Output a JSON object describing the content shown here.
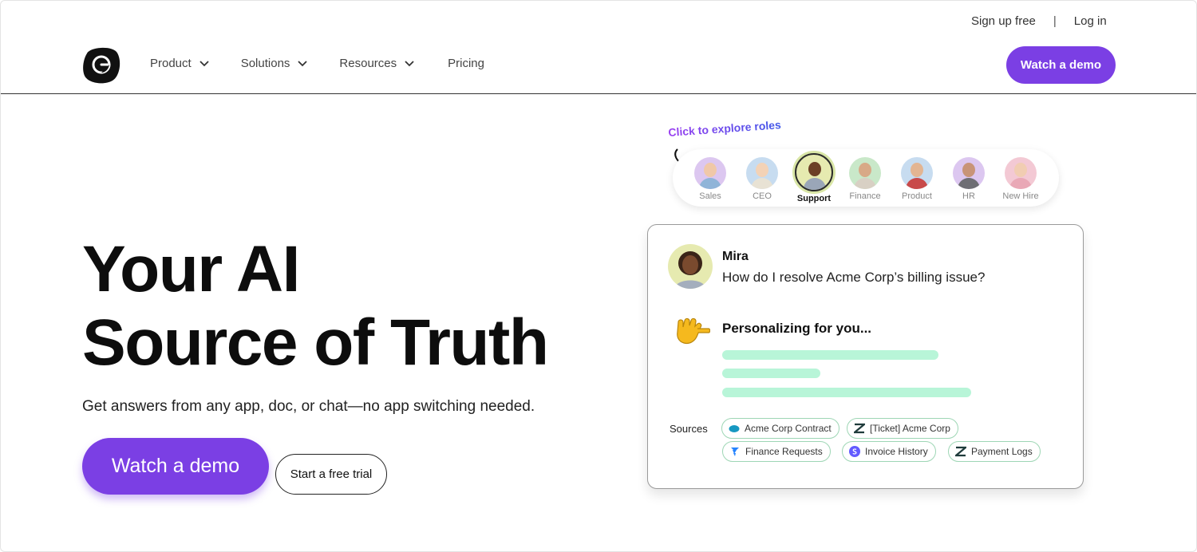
{
  "util": {
    "signup": "Sign up free",
    "separator": "|",
    "login": "Log in"
  },
  "nav": {
    "items": [
      {
        "label": "Product"
      },
      {
        "label": "Solutions"
      },
      {
        "label": "Resources"
      },
      {
        "label": "Pricing"
      }
    ],
    "cta": "Watch a demo"
  },
  "hero": {
    "title_line1": "Your AI",
    "title_line2": "Source of Truth",
    "subtitle": "Get answers from any app, doc, or chat—no app switching needed.",
    "primary_button": "Watch a demo",
    "secondary_button": "Start a free trial"
  },
  "roles": {
    "prompt": "Click to explore roles",
    "selected": "Support",
    "items": [
      {
        "label": "Sales"
      },
      {
        "label": "CEO"
      },
      {
        "label": "Support"
      },
      {
        "label": "Finance"
      },
      {
        "label": "Product"
      },
      {
        "label": "HR"
      },
      {
        "label": "New Hire"
      }
    ]
  },
  "chat": {
    "name": "Mira",
    "question": "How do I resolve Acme Corp’s billing issue?",
    "status": "Personalizing for you...",
    "sources_label": "Sources",
    "sources": [
      {
        "label": "Acme Corp Contract",
        "icon": "salesforce-icon"
      },
      {
        "label": "[Ticket] Acme Corp",
        "icon": "zendesk-icon"
      },
      {
        "label": "Finance Requests",
        "icon": "jira-icon"
      },
      {
        "label": "Invoice History",
        "icon": "stripe-icon"
      },
      {
        "label": "Payment Logs",
        "icon": "zendesk-icon"
      }
    ]
  },
  "colors": {
    "brand": "#7b3fe4",
    "progress": "#b8f5d8",
    "chip_border": "#9ed6b5"
  }
}
